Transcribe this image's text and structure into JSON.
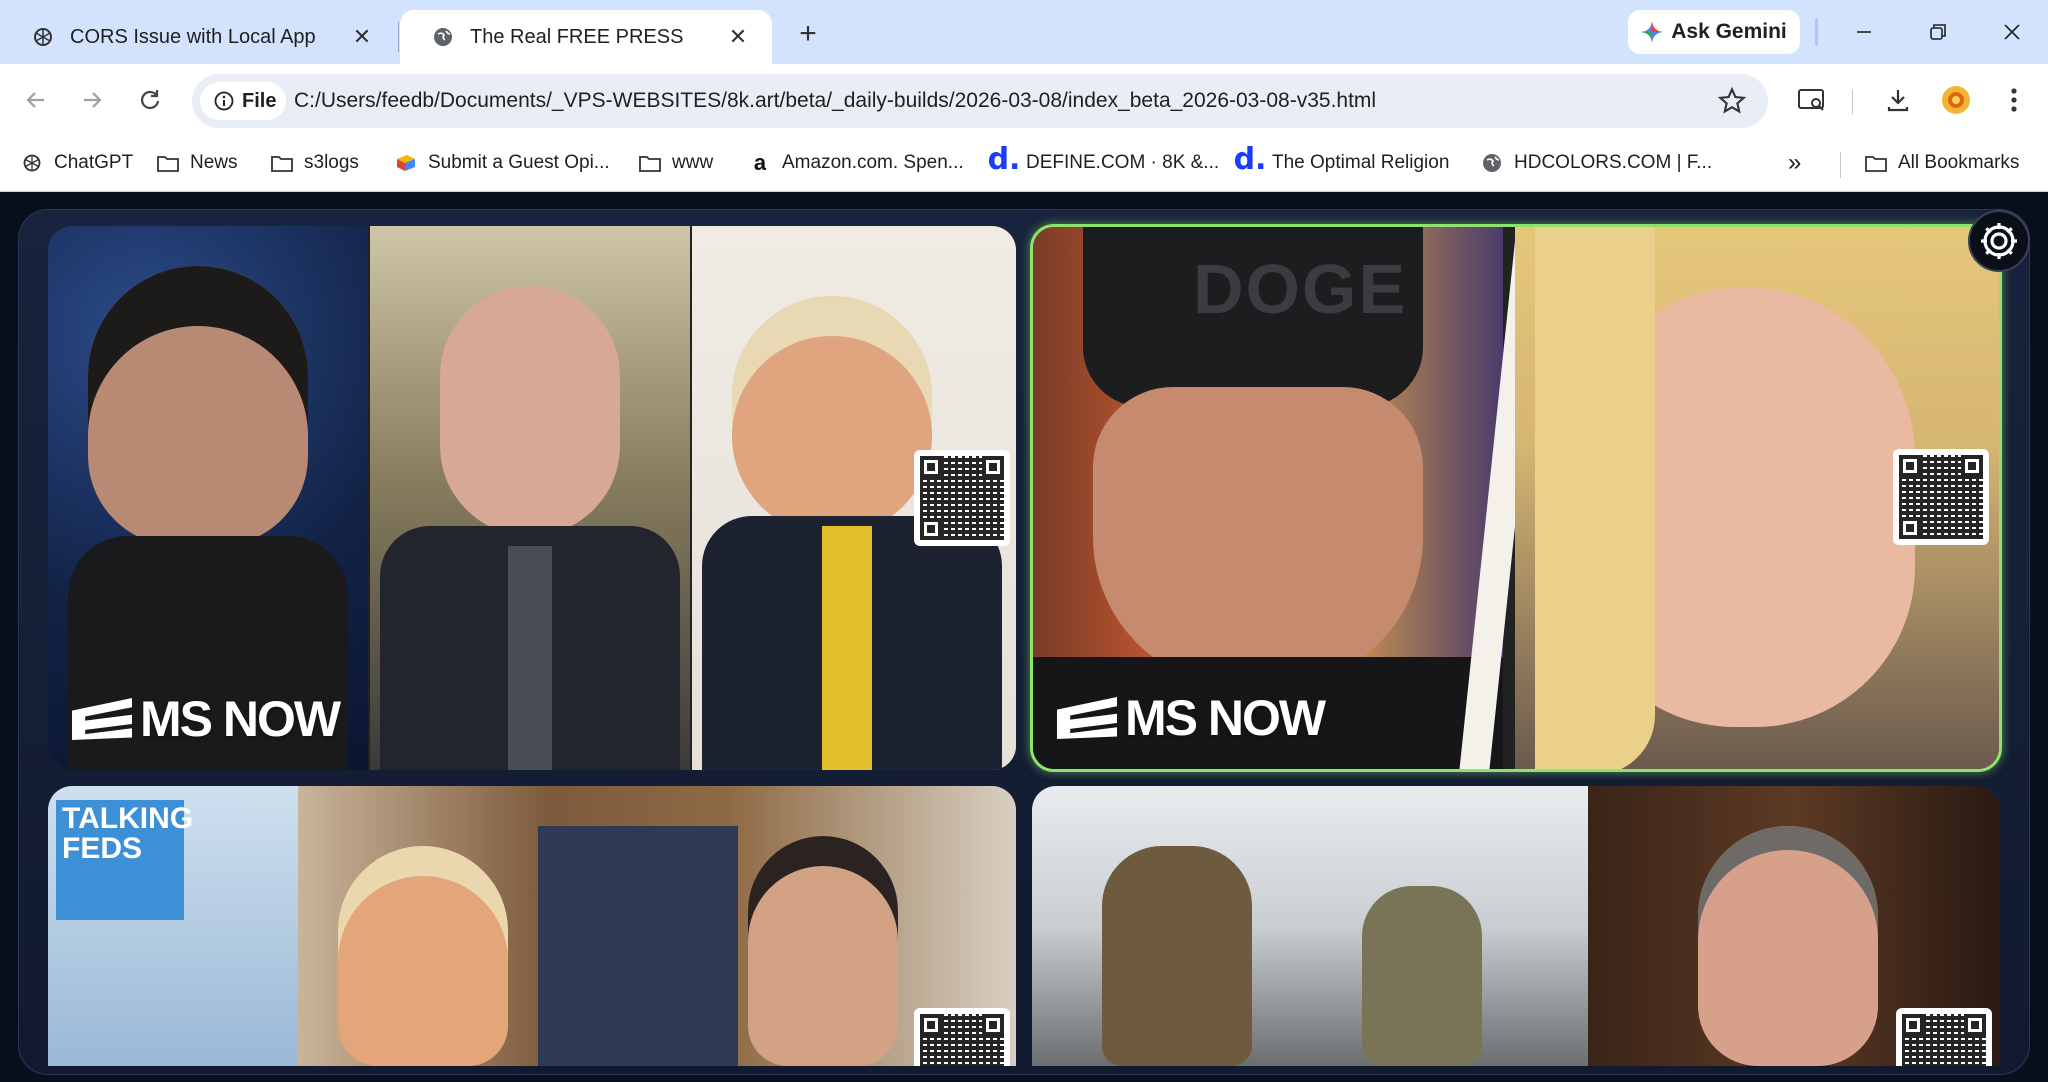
{
  "tabs": [
    {
      "title": "CORS Issue with Local App",
      "favicon": "chatgpt-icon"
    },
    {
      "title": "The Real FREE PRESS",
      "favicon": "globe-icon",
      "active": true
    }
  ],
  "gemini_label": "Ask Gemini",
  "omnibox": {
    "scheme_label": "File",
    "url": "C:/Users/feedb/Documents/_VPS-WEBSITES/8k.art/beta/_daily-builds/2026-03-08/index_beta_2026-03-08-v35.html"
  },
  "bookmarks": [
    {
      "label": "ChatGPT",
      "icon": "chatgpt-icon"
    },
    {
      "label": "News",
      "icon": "folder-icon"
    },
    {
      "label": "s3logs",
      "icon": "folder-icon"
    },
    {
      "label": "Submit a Guest Opi...",
      "icon": "colorful-flag-icon"
    },
    {
      "label": "www",
      "icon": "folder-icon"
    },
    {
      "label": "Amazon.com. Spen...",
      "icon": "amazon-icon"
    },
    {
      "label": "DEFINE.COM · 8K &...",
      "icon": "define-d-icon"
    },
    {
      "label": "The Optimal Religion",
      "icon": "define-d-icon"
    },
    {
      "label": "HDCOLORS.COM | F...",
      "icon": "globe-icon"
    }
  ],
  "overflow_label": "»",
  "all_bookmarks_label": "All Bookmarks",
  "cards": [
    {
      "logo": "MS NOW"
    },
    {
      "logo": "MS NOW",
      "hat_text": "DOGE"
    },
    {
      "badge": "TALKING FEDS"
    },
    {}
  ],
  "colors": {
    "tab_strip": "#d3e3fd",
    "highlight_border": "#8de36b",
    "page_bg": "#0a0f1c"
  }
}
